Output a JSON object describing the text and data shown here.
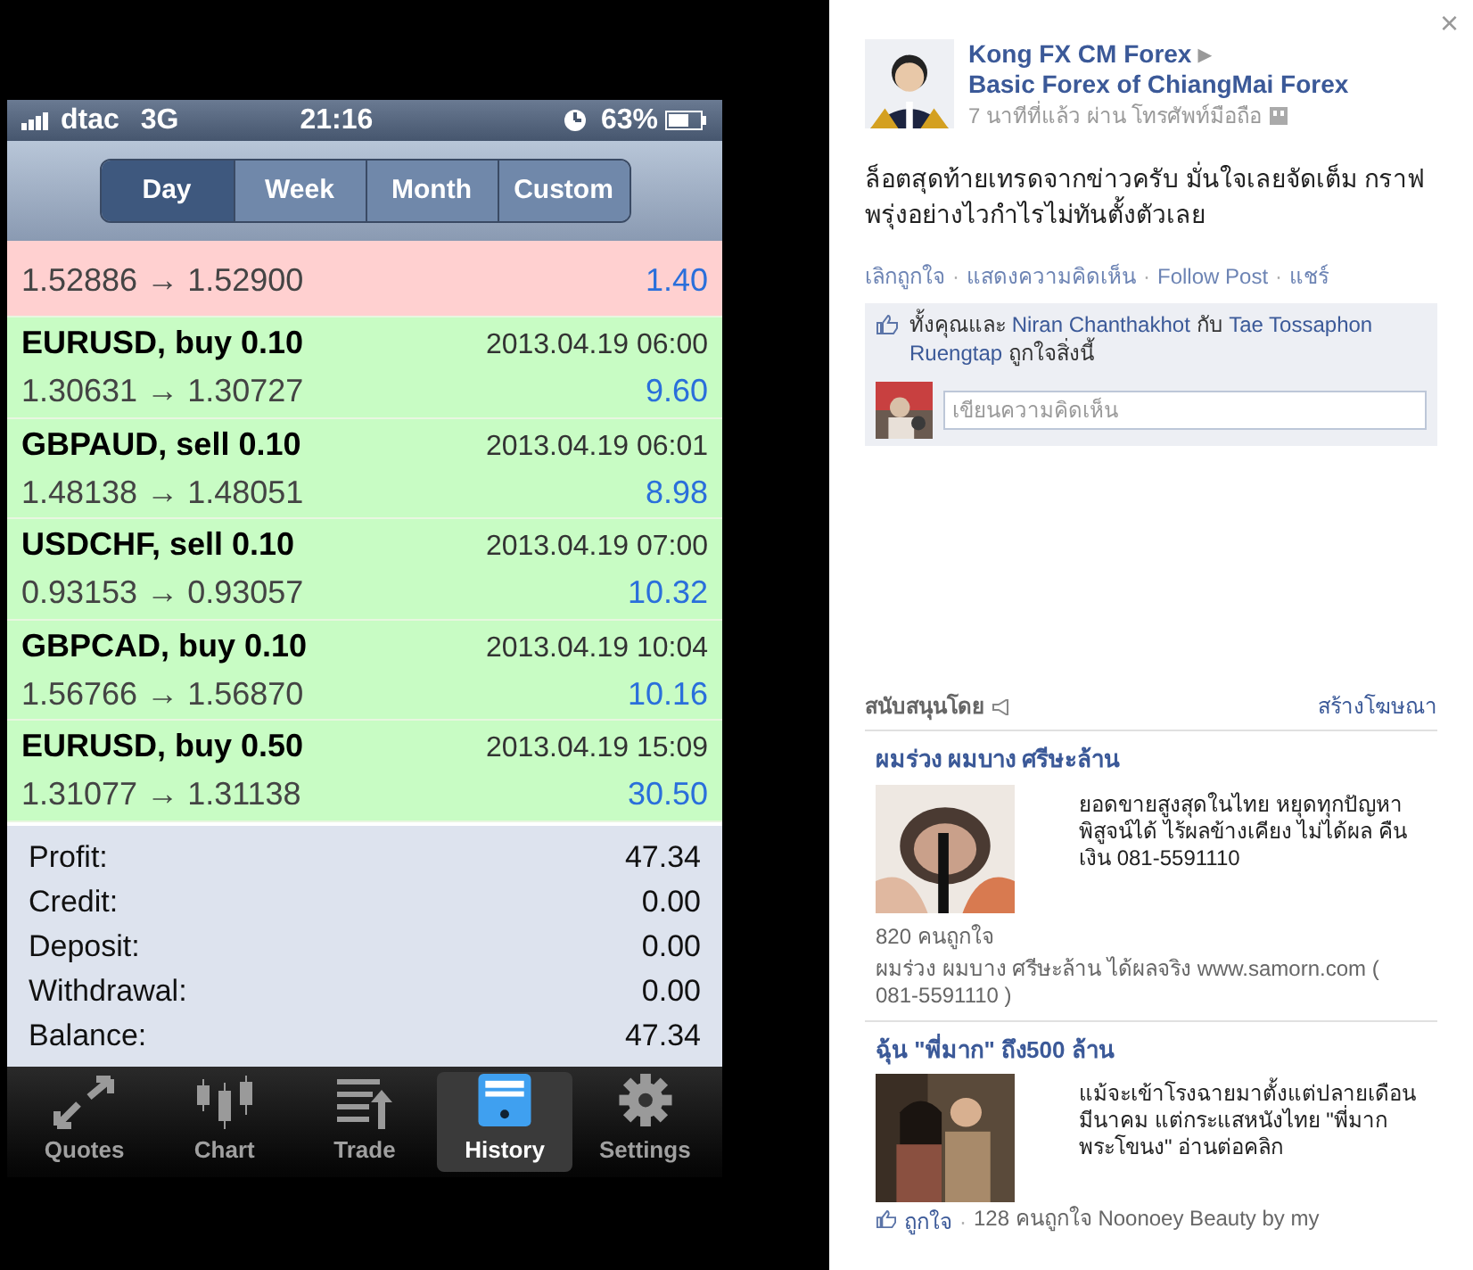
{
  "phone": {
    "status_bar": {
      "carrier": "dtac",
      "network": "3G",
      "time": "21:16",
      "battery": "63%"
    },
    "period_tabs": [
      {
        "label": "Day",
        "selected": true
      },
      {
        "label": "Week",
        "selected": false
      },
      {
        "label": "Month",
        "selected": false
      },
      {
        "label": "Custom",
        "selected": false
      }
    ],
    "trades": [
      {
        "prices": "1.52886 → 1.52900",
        "profit": "1.40",
        "color": "#ffd0d0"
      },
      {
        "title": "EURUSD, buy 0.10",
        "date": "2013.04.19 06:00",
        "prices": "1.30631 → 1.30727",
        "profit": "9.60",
        "color": "#c8fcc4"
      },
      {
        "title": "GBPAUD, sell 0.10",
        "date": "2013.04.19 06:01",
        "prices": "1.48138 → 1.48051",
        "profit": "8.98",
        "color": "#c8fcc4"
      },
      {
        "title": "USDCHF, sell 0.10",
        "date": "2013.04.19 07:00",
        "prices": "0.93153 → 0.93057",
        "profit": "10.32",
        "color": "#c8fcc4"
      },
      {
        "title": "GBPCAD, buy 0.10",
        "date": "2013.04.19 10:04",
        "prices": "1.56766 → 1.56870",
        "profit": "10.16",
        "color": "#c8fcc4"
      },
      {
        "title": "EURUSD, buy 0.50",
        "date": "2013.04.19 15:09",
        "prices": "1.31077 → 1.31138",
        "profit": "30.50",
        "color": "#c8fcc4"
      }
    ],
    "summary": [
      {
        "label": "Profit:",
        "value": "47.34"
      },
      {
        "label": "Credit:",
        "value": "0.00"
      },
      {
        "label": "Deposit:",
        "value": "0.00"
      },
      {
        "label": "Withdrawal:",
        "value": "0.00"
      },
      {
        "label": "Balance:",
        "value": "47.34"
      }
    ],
    "bottom_tabs": [
      {
        "label": "Quotes",
        "kind": "quotes",
        "selected": false
      },
      {
        "label": "Chart",
        "kind": "chart",
        "selected": false
      },
      {
        "label": "Trade",
        "kind": "trade",
        "selected": false
      },
      {
        "label": "History",
        "kind": "history",
        "selected": true
      },
      {
        "label": "Settings",
        "kind": "settings",
        "selected": false
      }
    ]
  },
  "close": "×",
  "post": {
    "author": "Kong FX CM Forex",
    "arrow": "▸",
    "target": "Basic Forex of ChiangMai Forex",
    "meta": "7 นาทีที่แล้ว ผ่าน โทรศัพท์มือถือ",
    "text": "ล็อตสุดท้ายเทรดจากข่าวครับ มั่นใจเลยจัดเต็ม กราฟพรุ่งอย่างไวกำไรไม่ทันตั้งตัวเลย",
    "actions": [
      "เลิกถูกใจ",
      "แสดงความคิดเห็น",
      "Follow Post",
      "แชร์"
    ],
    "separator": "·",
    "likes": {
      "prefix": "ทั้งคุณและ",
      "name1": "Niran Chanthakhot",
      "joiner": "กับ",
      "name2": "Tae Tossaphon Ruengtap",
      "suffix": "ถูกใจสิ่งนี้"
    },
    "comment": {
      "placeholder": "เขียนความคิดเห็น"
    }
  },
  "sponsored": {
    "title": "สนับสนุนโดย",
    "create": "สร้างโฆษณา",
    "ads": [
      {
        "title": "ผมร่วง ผมบาง ศรีษะล้าน",
        "body": "ยอดขายสูงสุดในไทย หยุดทุกปัญหา พิสูจน์ได้ ไร้ผลข้างเคียง ไม่ได้ผล คืนเงิน 081-5591110",
        "likes": "820 คนถูกใจ",
        "footer": "ผมร่วง ผมบาง ศรีษะล้าน ได้ผลจริง www.samorn.com ( 081-5591110 )"
      },
      {
        "title": "ฉุ้น \"พี่มาก\" ถึง500 ล้าน",
        "body": "แม้จะเข้าโรงฉายมาตั้งแต่ปลายเดือนมีนาคม แต่กระแสหนังไทย \"พี่มาก พระโขนง\" อ่านต่อคลิก",
        "footer": "128 คนถูกใจ Noonoey Beauty by my",
        "like_link": "ถูกใจ",
        "separator": "·"
      }
    ]
  }
}
